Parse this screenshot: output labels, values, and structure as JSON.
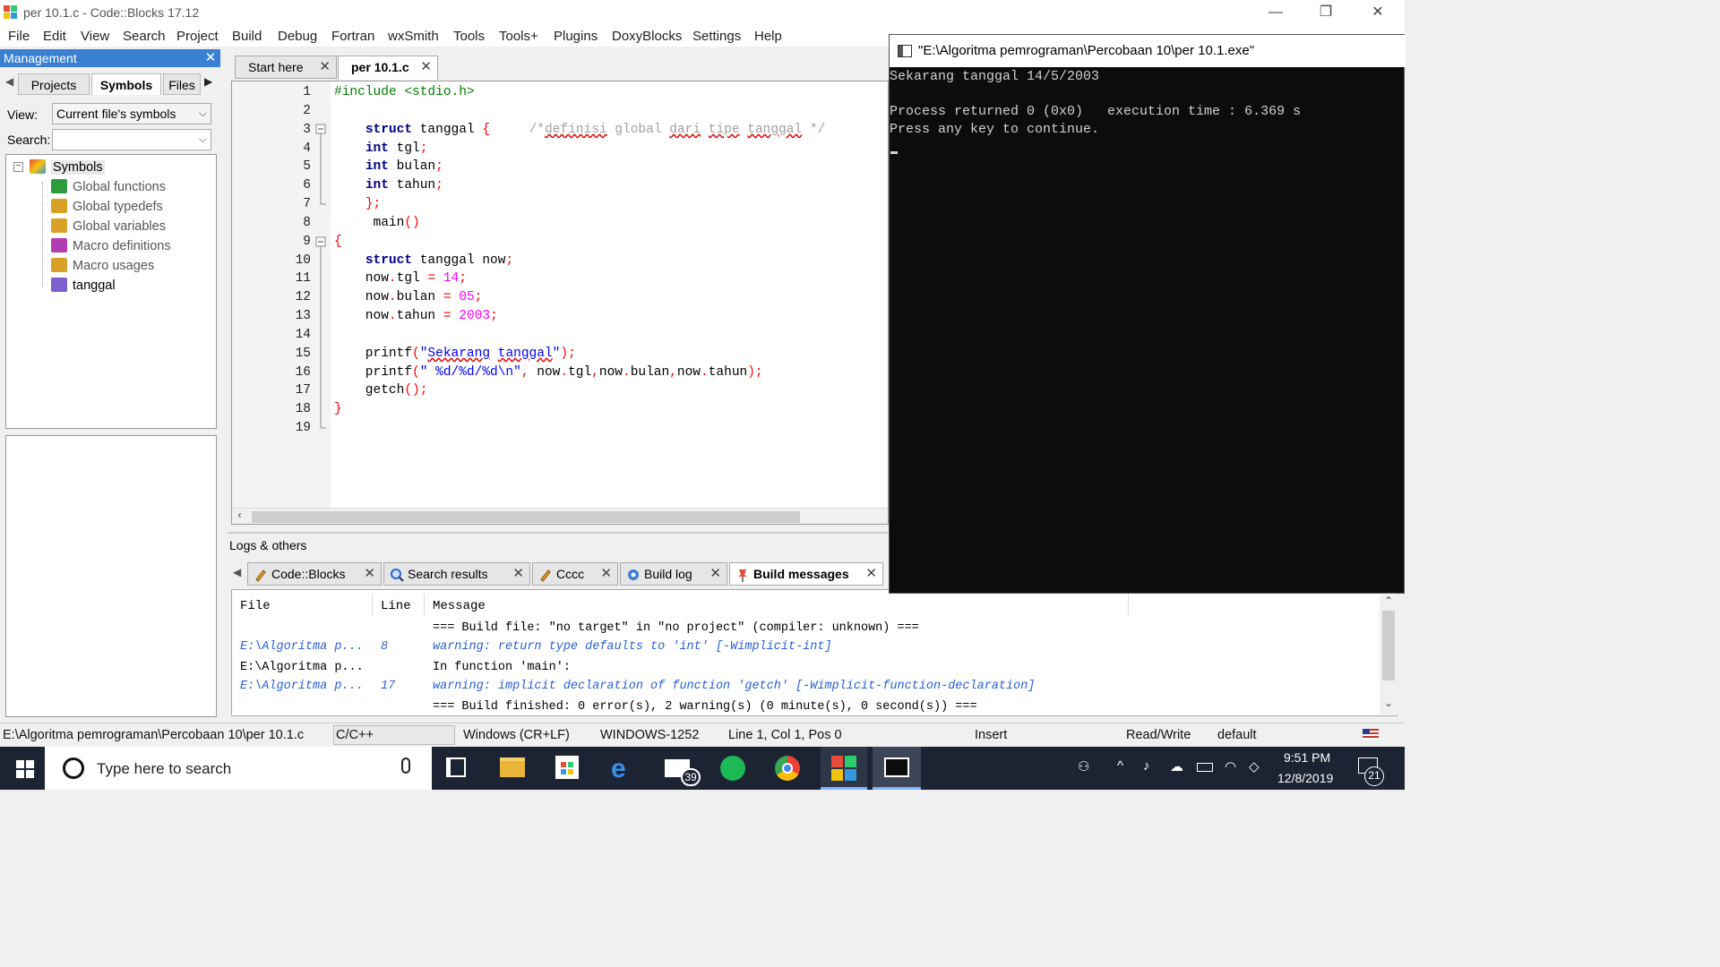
{
  "window": {
    "title": "per 10.1.c - Code::Blocks 17.12",
    "controls": [
      "—",
      "❐",
      "✕"
    ]
  },
  "menu": [
    "File",
    "Edit",
    "View",
    "Search",
    "Project",
    "Build",
    "Debug",
    "Fortran",
    "wxSmith",
    "Tools",
    "Tools+",
    "Plugins",
    "DoxyBlocks",
    "Settings",
    "Help"
  ],
  "management": {
    "title": "Management",
    "tabs": [
      "Projects",
      "Symbols",
      "Files"
    ],
    "active_tab": "Symbols",
    "view_label": "View:",
    "view_value": "Current file's symbols",
    "search_label": "Search:",
    "search_value": "",
    "tree": [
      {
        "label": "Symbols",
        "color": "#c0392b"
      },
      {
        "label": "Global functions",
        "color": "#2e9b3d"
      },
      {
        "label": "Global typedefs",
        "color": "#d9a227"
      },
      {
        "label": "Global variables",
        "color": "#d9a227"
      },
      {
        "label": "Macro definitions",
        "color": "#b23cb2"
      },
      {
        "label": "Macro usages",
        "color": "#d9a227"
      },
      {
        "label": "tanggal",
        "color": "#7b61c9"
      }
    ]
  },
  "editor": {
    "tabs": [
      "Start here",
      "per 10.1.c"
    ],
    "active_tab": "per 10.1.c",
    "line_numbers": [
      "1",
      "2",
      "3",
      "4",
      "5",
      "6",
      "7",
      "8",
      "9",
      "10",
      "11",
      "12",
      "13",
      "14",
      "15",
      "16",
      "17",
      "18",
      "19"
    ]
  },
  "console": {
    "title": "\"E:\\Algoritma pemrograman\\Percobaan 10\\per 10.1.exe\"",
    "lines": [
      "Sekarang tanggal 14/5/2003",
      "",
      "Process returned 0 (0x0)   execution time : 6.369 s",
      "Press any key to continue."
    ]
  },
  "logs": {
    "title": "Logs & others",
    "tabs": [
      "Code::Blocks",
      "Search results",
      "Cccc",
      "Build log",
      "Build messages"
    ],
    "active_tab": "Build messages",
    "headers": {
      "file": "File",
      "line": "Line",
      "message": "Message"
    },
    "rows": [
      {
        "file": "",
        "line": "",
        "message": "=== Build file: \"no target\" in \"no project\" (compiler: unknown) ===",
        "warn": false
      },
      {
        "file": "E:\\Algoritma p...",
        "line": "8",
        "message": "warning: return type defaults to 'int' [-Wimplicit-int]",
        "warn": true
      },
      {
        "file": "E:\\Algoritma p...",
        "line": "",
        "message": "In function 'main':",
        "warn": false
      },
      {
        "file": "E:\\Algoritma p...",
        "line": "17",
        "message": "warning: implicit declaration of function 'getch' [-Wimplicit-function-declaration]",
        "warn": true
      },
      {
        "file": "",
        "line": "",
        "message": "=== Build finished: 0 error(s), 2 warning(s) (0 minute(s), 0 second(s)) ===",
        "warn": false
      }
    ]
  },
  "status": {
    "path": "E:\\Algoritma pemrograman\\Percobaan 10\\per 10.1.c",
    "language": "C/C++",
    "eol": "Windows (CR+LF)",
    "encoding": "WINDOWS-1252",
    "position": "Line 1, Col 1, Pos 0",
    "mode": "Insert",
    "access": "Read/Write",
    "profile": "default"
  },
  "taskbar": {
    "search_placeholder": "Type here to search",
    "mail_badge": "39",
    "time": "9:51 PM",
    "date": "12/8/2019",
    "notification_count": "21"
  }
}
